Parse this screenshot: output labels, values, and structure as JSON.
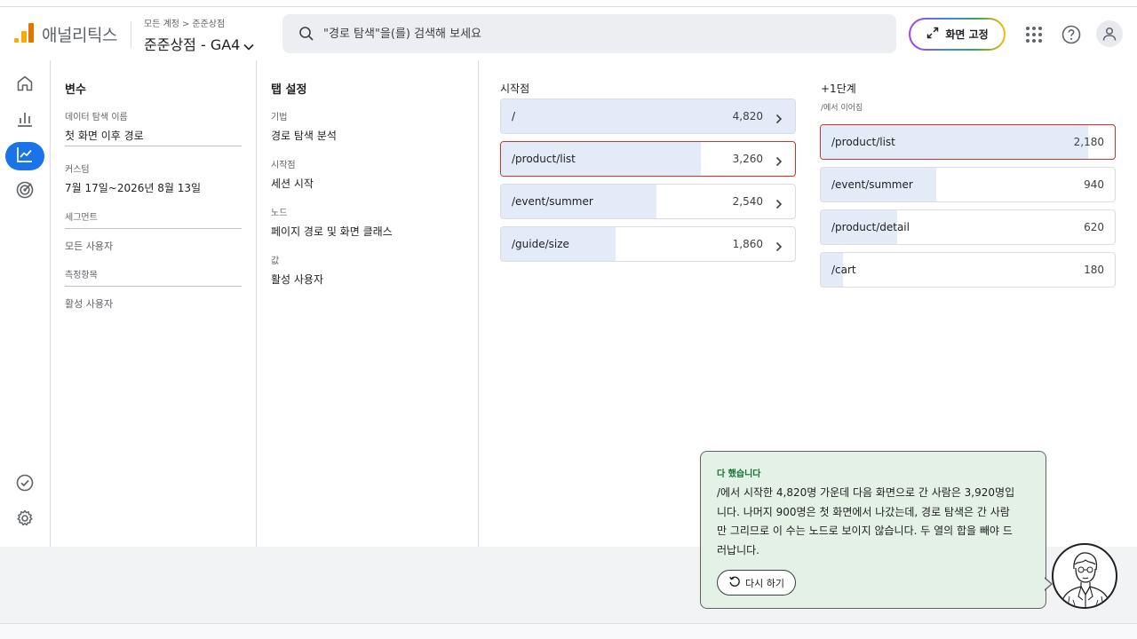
{
  "header": {
    "app_title": "애널리틱스",
    "breadcrumb": [
      "모든 계정",
      "준준상점"
    ],
    "property": "준준상점 - GA4",
    "search_placeholder": "\"경로 탐색\"을(를) 검색해 보세요",
    "pin_button": "화면 고정"
  },
  "variables": {
    "title": "변수",
    "exploration_name_label": "데이터 탐색 이름",
    "exploration_name": "첫 화면 이후 경로",
    "date_label": "커스텀",
    "date_range": "7월 17일~2026년 8월 13일",
    "segments_label": "세그먼트",
    "segment_item": "모든 사용자",
    "metrics_label": "측정항목",
    "metric_item": "활성 사용자"
  },
  "tab_settings": {
    "title": "탭 설정",
    "technique_label": "기법",
    "technique": "경로 탐색 분석",
    "start_label": "시작점",
    "start": "세션 시작",
    "node_label": "노드",
    "node": "페이지 경로 및 화면 클래스",
    "value_label": "값",
    "value": "활성 사용자"
  },
  "start_column": {
    "title": "시작점",
    "nodes": [
      {
        "label": "/",
        "value": "4,820",
        "users": 4820,
        "selected": false
      },
      {
        "label": "/product/list",
        "value": "3,260",
        "users": 3260,
        "selected": true
      },
      {
        "label": "/event/summer",
        "value": "2,540",
        "users": 2540,
        "selected": false
      },
      {
        "label": "/guide/size",
        "value": "1,860",
        "users": 1860,
        "selected": false
      }
    ]
  },
  "step_column": {
    "title": "+1단계",
    "subtitle": "/에서 이어짐",
    "nodes": [
      {
        "label": "/product/list",
        "value": "2,180",
        "users": 2180,
        "selected": true
      },
      {
        "label": "/event/summer",
        "value": "940",
        "users": 940,
        "selected": false
      },
      {
        "label": "/product/detail",
        "value": "620",
        "users": 620,
        "selected": false
      },
      {
        "label": "/cart",
        "value": "180",
        "users": 180,
        "selected": false
      }
    ]
  },
  "assistant": {
    "heading": "다 했습니다",
    "message": "/에서 시작한 4,820명 가운데 다음 화면으로 간 사람은 3,920명입니다. 나머지 900명은 첫 화면에서 나갔는데, 경로 탐색은 간 사람만 그리므로 이 수는 노드로 보이지 않습니다. 두 열의 합을 빼야 드러납니다.",
    "retry_label": "다시 하기"
  },
  "colors": {
    "accent": "#1a73e8",
    "node_fill": "#e3ebf8",
    "selected_border": "#d93025",
    "card_bg": "#e3f1e6",
    "card_heading": "#137333"
  },
  "icons": {
    "nav": [
      "home-icon",
      "reports-icon",
      "explore-icon",
      "advertising-icon",
      "check-circle-icon",
      "gear-icon"
    ],
    "header": [
      "search-icon",
      "expand-icon",
      "apps-grid-icon",
      "help-icon",
      "account-icon"
    ]
  }
}
